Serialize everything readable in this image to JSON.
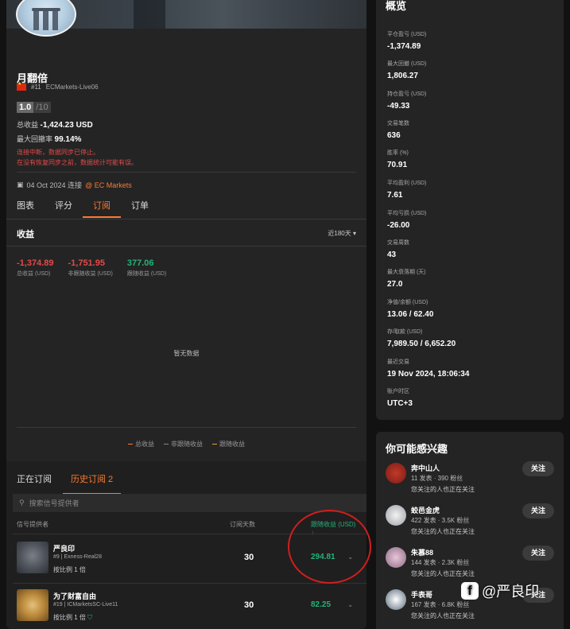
{
  "profile": {
    "name": "月翻倍",
    "rank": "#11",
    "account": "ECMarkets-Live06",
    "score": "1.0",
    "score_max": "/10",
    "total_return_label": "总收益",
    "total_return_value": "-1,424.23 USD",
    "max_drawdown_label": "最大回撤率",
    "max_drawdown_value": "99.14%",
    "warning_1": "连接中断，数据同步已停止。",
    "warning_2": "在没有恢复同步之前，数据统计可能有误。",
    "since": "04 Oct 2024 连接",
    "broker": "EC Markets"
  },
  "tabs": [
    "图表",
    "评分",
    "订阅",
    "订单"
  ],
  "earnings": {
    "title": "收益",
    "range": "近180天 ▾",
    "kpis": [
      {
        "value": "-1,374.89",
        "label": "总收益 (USD)",
        "color": "#e24a4a"
      },
      {
        "value": "-1,751.95",
        "label": "非跟随收益 (USD)",
        "color": "#e24a4a"
      },
      {
        "value": "377.06",
        "label": "跟随收益 (USD)",
        "color": "#26b07a"
      }
    ],
    "empty": "暂无数据",
    "legend": [
      "总收益",
      "非跟随收益",
      "跟随收益"
    ]
  },
  "subscriptions": {
    "tabs": [
      "正在订阅",
      "历史订阅 2"
    ],
    "search_placeholder": "搜索信号提供者",
    "headers": [
      "信号提供者",
      "订阅天数",
      "跟随收益 (USD) ↓"
    ],
    "rows": [
      {
        "name": "严良印",
        "meta": "#9 | Exness-Real28",
        "ratio": "按比例 1 倍",
        "days": "30",
        "earn": "294.81"
      },
      {
        "name": "为了财富自由",
        "meta": "#19 | ICMarketsSC-Live11",
        "ratio": "按比例 1 倍",
        "days": "30",
        "earn": "82.25"
      }
    ]
  },
  "overview": {
    "title": "概览",
    "items": [
      {
        "label": "平仓盈亏 (USD)",
        "value": "-1,374.89",
        "color": "#e24a4a"
      },
      {
        "label": "最大回撤 (USD)",
        "value": "1,806.27",
        "color": "#ffffff"
      },
      {
        "label": "持仓盈亏 (USD)",
        "value": "-49.33",
        "color": "#e24a4a"
      },
      {
        "label": "交易笔数",
        "value": "636",
        "color": "#ffffff"
      },
      {
        "label": "胜率 (%)",
        "value": "70.91",
        "color": "#ffffff"
      },
      {
        "label": "平均盈利 (USD)",
        "value": "7.61",
        "color": "#ffffff"
      },
      {
        "label": "平均亏损 (USD)",
        "value": "-26.00",
        "color": "#ffffff"
      },
      {
        "label": "交易周数",
        "value": "43",
        "color": "#ffffff"
      },
      {
        "label": "最大衰落期 (天)",
        "value": "27.0",
        "color": "#ffffff"
      },
      {
        "label": "净值/余额 (USD)",
        "value": "13.06 / 62.40",
        "color": "#ffffff"
      },
      {
        "label": "存/取款 (USD)",
        "value": "7,989.50 / 6,652.20",
        "color": "#ffffff"
      },
      {
        "label": "最近交易",
        "value": "19 Nov 2024, 18:06:34",
        "color": "#ffffff"
      },
      {
        "label": "账户时区",
        "value": "UTC+3",
        "color": "#ffffff"
      }
    ]
  },
  "interest": {
    "title": "你可能感兴趣",
    "follow_label": "关注",
    "people": [
      {
        "name": "奔中山人",
        "stats": "11 发表 · 390 粉丝",
        "note": "您关注的人也正在关注"
      },
      {
        "name": "蛟邑金虎",
        "stats": "422 发表 · 3.5K 粉丝",
        "note": "您关注的人也正在关注"
      },
      {
        "name": "朱慕88",
        "stats": "144 发表 · 2.3K 粉丝",
        "note": "您关注的人也正在关注"
      },
      {
        "name": "手表哥",
        "stats": "167 发表 · 6.8K 粉丝",
        "note": "您关注的人也正在关注"
      }
    ]
  },
  "watermark": "@严良印"
}
